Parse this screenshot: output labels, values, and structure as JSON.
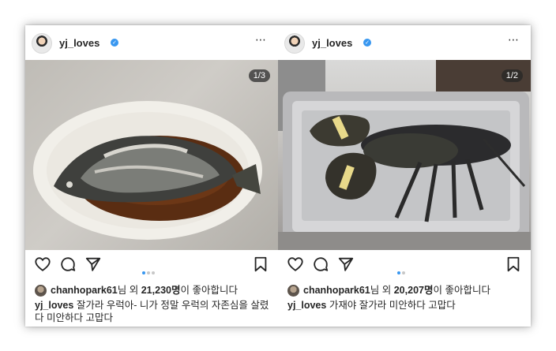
{
  "posts": [
    {
      "username": "yj_loves",
      "verified_mark": "✓",
      "more_icon": "⋯",
      "image_counter": "1/3",
      "image_description_icon": "photo",
      "carousel": {
        "count": 3,
        "active": 0
      },
      "likes": {
        "user": "chanhopark61",
        "prefix_suffix": "님 외",
        "count": "21,230명",
        "suffix": "이 좋아합니다"
      },
      "caption": {
        "user": "yj_loves",
        "text": "잘가라 우럭아- 니가 정말 우럭의 자존심을 살렸다 미안하다 고맙다"
      }
    },
    {
      "username": "yj_loves",
      "verified_mark": "✓",
      "more_icon": "⋯",
      "image_counter": "1/2",
      "image_description_icon": "photo",
      "carousel": {
        "count": 2,
        "active": 0
      },
      "likes": {
        "user": "chanhopark61",
        "prefix_suffix": "님 외",
        "count": "20,207명",
        "suffix": "이 좋아합니다"
      },
      "caption": {
        "user": "yj_loves",
        "text": "가재야 잘가라 미안하다 고맙다"
      }
    }
  ],
  "colors": {
    "accent": "#3897f0",
    "text": "#262626",
    "dot_inactive": "#c7c7c7"
  },
  "icons": [
    "heart-icon",
    "comment-icon",
    "share-icon",
    "bookmark-icon",
    "more-icon",
    "verified-icon"
  ]
}
